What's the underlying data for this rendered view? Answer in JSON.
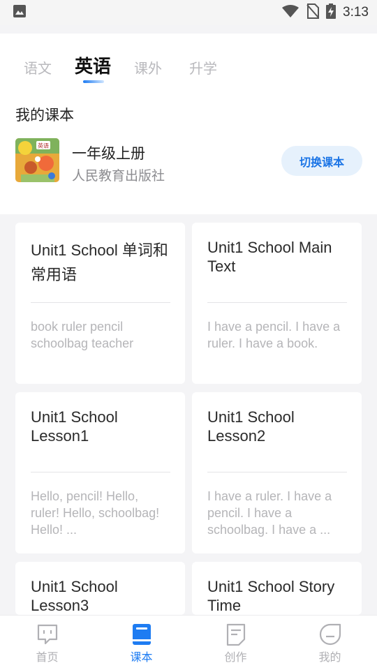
{
  "status_bar": {
    "time": "3:13",
    "icons": [
      "image-icon",
      "wifi-icon",
      "no-sim-icon",
      "battery-charging-icon"
    ]
  },
  "tabs": [
    {
      "label": "语文",
      "active": false
    },
    {
      "label": "英语",
      "active": true
    },
    {
      "label": "课外",
      "active": false
    },
    {
      "label": "升学",
      "active": false
    }
  ],
  "my_book": {
    "section_title": "我的课本",
    "name": "一年级上册",
    "publisher": "人民教育出版社",
    "switch_label": "切换课本",
    "cover_label": "英语"
  },
  "cards": [
    {
      "title": "Unit1 School 单词和常用语",
      "text": "book ruler pencil schoolbag teacher"
    },
    {
      "title": "Unit1 School Main Text",
      "text": "I have a pencil. I have a ruler. I have a book."
    },
    {
      "title": "Unit1 School Lesson1",
      "text": "Hello, pencil! Hello, ruler! Hello, schoolbag! Hello! ..."
    },
    {
      "title": "Unit1 School Lesson2",
      "text": "I have a ruler. I have a pencil. I have a schoolbag. I have a ..."
    },
    {
      "title": "Unit1 School Lesson3",
      "text": ""
    },
    {
      "title": "Unit1 School Story Time",
      "text": ""
    }
  ],
  "bottom_nav": [
    {
      "label": "首页",
      "icon": "home-chat-icon",
      "active": false
    },
    {
      "label": "课本",
      "icon": "book-icon",
      "active": true
    },
    {
      "label": "创作",
      "icon": "document-icon",
      "active": false
    },
    {
      "label": "我的",
      "icon": "profile-icon",
      "active": false
    }
  ],
  "colors": {
    "accent": "#1e7cf2",
    "inactive": "#b0b0b4",
    "background": "#f4f4f6",
    "switch_bg": "#e6f1fc"
  }
}
